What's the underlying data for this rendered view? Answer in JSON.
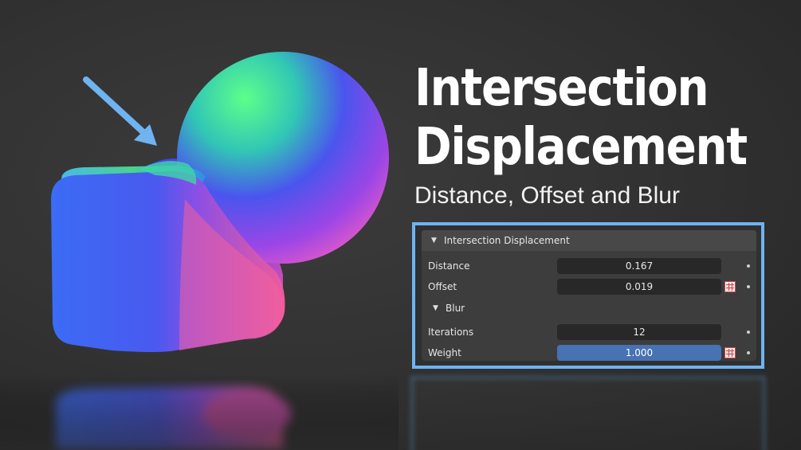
{
  "title": {
    "line1": "Intersection",
    "line2": "Displacement",
    "subtitle": "Distance, Offset and Blur"
  },
  "panel": {
    "header_label": "Intersection Displacement",
    "fields": [
      {
        "label": "Distance",
        "value": "0.167"
      },
      {
        "label": "Offset",
        "value": "0.019"
      }
    ],
    "blur": {
      "header_label": "Blur",
      "fields": [
        {
          "label": "Iterations",
          "value": "12"
        },
        {
          "label": "Weight",
          "value": "1.000"
        }
      ]
    }
  },
  "icons": {
    "arrow": "arrow-pointer-icon",
    "expand": "triangle-down-icon",
    "texture": "texture-grid-icon",
    "keyframe": "dot-icon"
  },
  "colors": {
    "accent": "#6fb3f0",
    "selected_field": "#4772b3",
    "background": "#333333"
  }
}
